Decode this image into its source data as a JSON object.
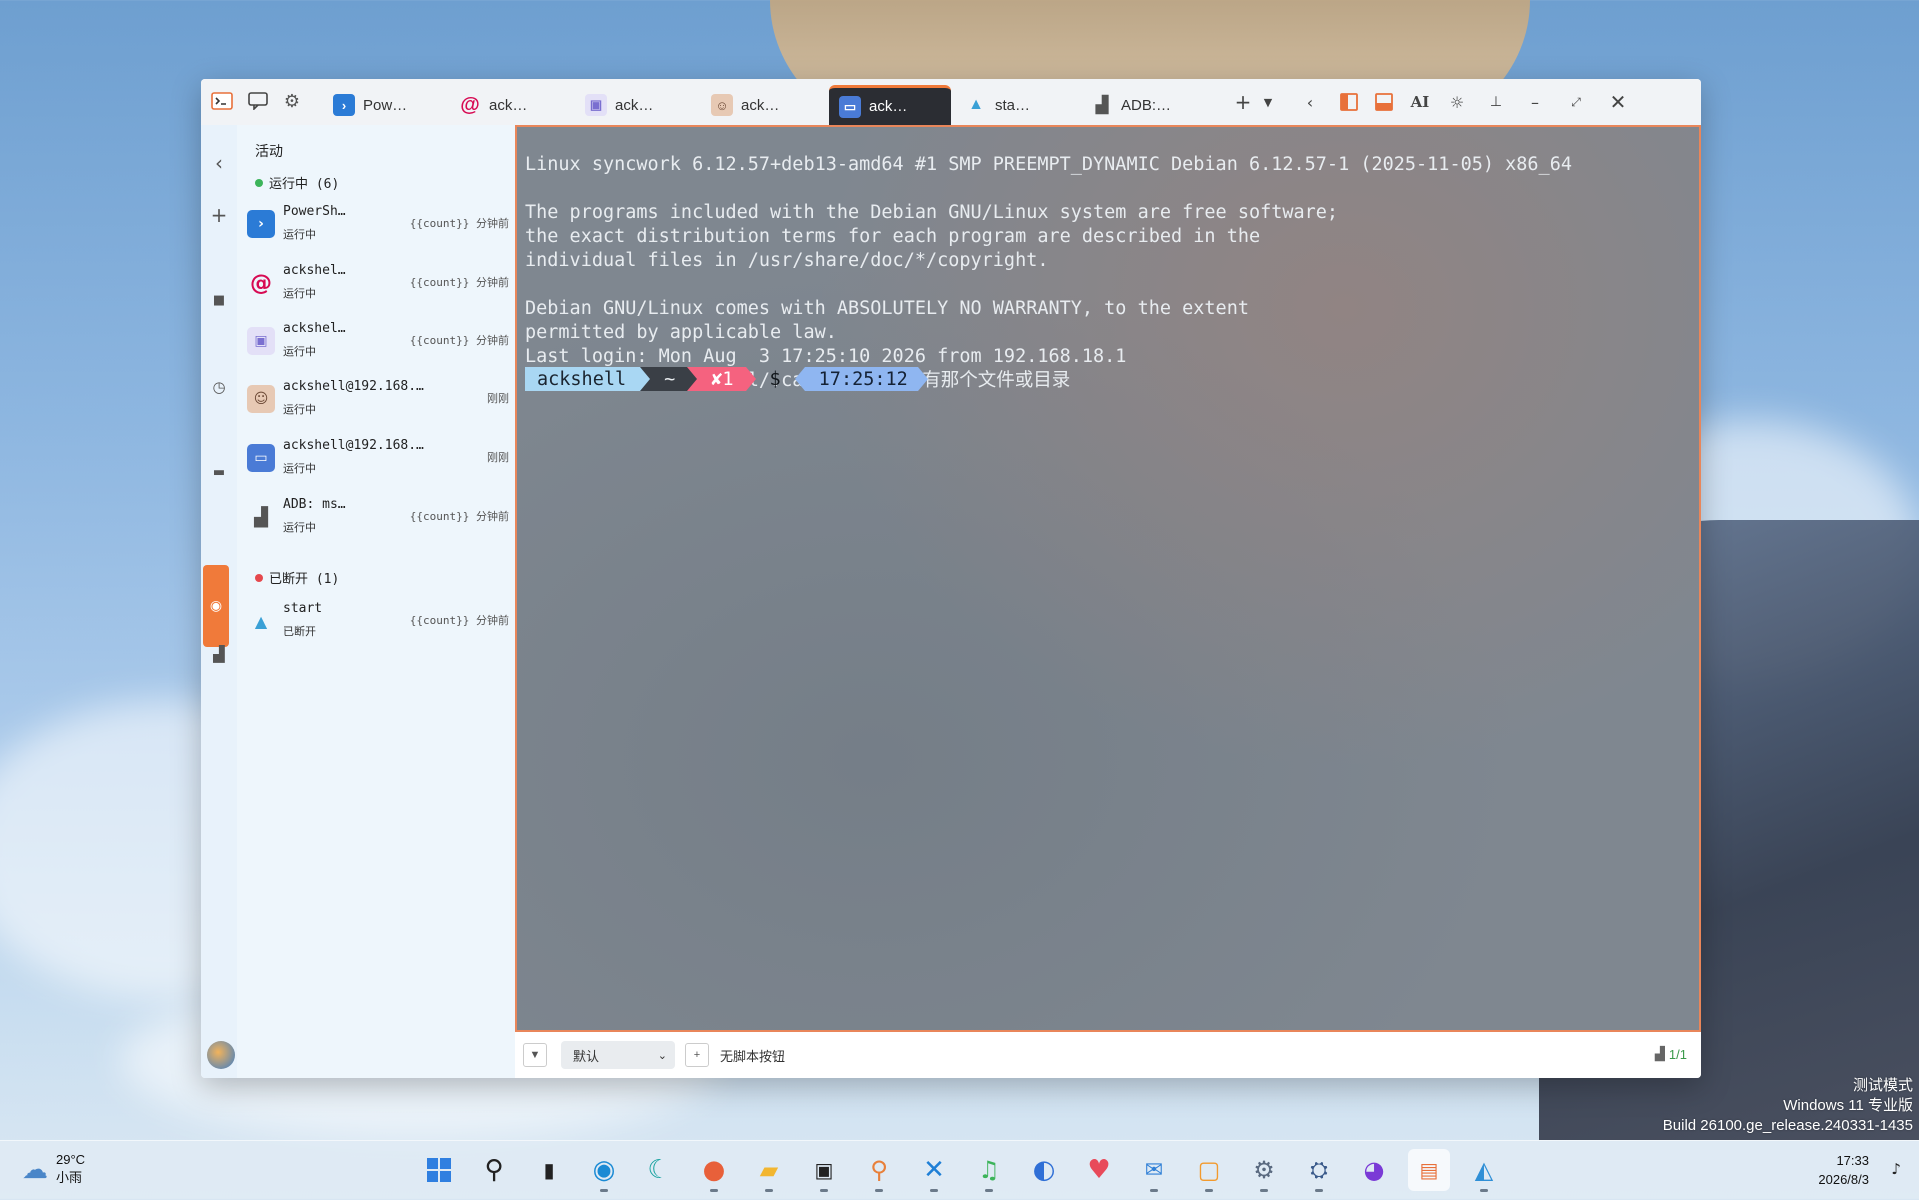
{
  "titlebar": {
    "tabs": [
      {
        "label": "Pow…",
        "icon": "powershell-icon",
        "color": "#2b7bd6"
      },
      {
        "label": "ack…",
        "icon": "debian-icon",
        "color": "#d70a53"
      },
      {
        "label": "ack…",
        "icon": "server-icon",
        "color": "#7a6fd0"
      },
      {
        "label": "ack…",
        "icon": "avatar-icon",
        "color": "#c89a7a"
      },
      {
        "label": "ack…",
        "icon": "remote-desktop-icon",
        "color": "#4a7bd6",
        "active": true
      },
      {
        "label": "sta…",
        "icon": "rocket-icon",
        "color": "#3aa0d6"
      },
      {
        "label": "ADB:…",
        "icon": "android-icon",
        "color": "#555555"
      }
    ],
    "ai_label": "AI"
  },
  "sidebar": {
    "header": "活动",
    "running_group": "运行中 (6)",
    "disconnected_group": "已断开 (1)",
    "running_sessions": [
      {
        "name": "PowerSh…",
        "status": "运行中",
        "time": "{{count}} 分钟前",
        "icon": "powershell-icon"
      },
      {
        "name": "ackshel…",
        "status": "运行中",
        "time": "{{count}} 分钟前",
        "icon": "debian-icon"
      },
      {
        "name": "ackshel…",
        "status": "运行中",
        "time": "{{count}} 分钟前",
        "icon": "server-icon"
      },
      {
        "name": "ackshell@192.168.…",
        "status": "运行中",
        "time": "刚刚",
        "icon": "avatar-icon"
      },
      {
        "name": "ackshell@192.168.…",
        "status": "运行中",
        "time": "刚刚",
        "icon": "remote-desktop-icon"
      },
      {
        "name": "ADB: ms…",
        "status": "运行中",
        "time": "{{count}} 分钟前",
        "icon": "android-icon"
      }
    ],
    "disconnected_sessions": [
      {
        "name": "start",
        "status": "已断开",
        "time": "{{count}} 分钟前",
        "icon": "rocket-icon"
      }
    ]
  },
  "terminal": {
    "lines": [
      "Linux syncwork 6.12.57+deb13-amd64 #1 SMP PREEMPT_DYNAMIC Debian 6.12.57-1 (2025-11-05) x86_64",
      "",
      "The programs included with the Debian GNU/Linux system are free software;",
      "the exact distribution terms for each program are described in the",
      "individual files in /usr/share/doc/*/copyright.",
      "",
      "Debian GNU/Linux comes with ABSOLUTELY NO WARRANTY, to the extent",
      "permitted by applicable law.",
      "Last login: Mon Aug  3 17:25:10 2026 from 192.168.18.1",
      "-bash: /home/ackshell/.cargo/env: 没有那个文件或目录"
    ],
    "prompt": {
      "user": "ackshell",
      "dir": "~",
      "error": "✘1",
      "symbol": "$",
      "time": "17:25:12"
    }
  },
  "bottombar": {
    "profile": "默认",
    "no_script": "无脚本按钮",
    "counter": "1/1"
  },
  "watermark": {
    "line1": "测试模式",
    "line2": "Windows 11 专业版",
    "line3": "Build 26100.ge_release.240331-1435"
  },
  "taskbar": {
    "weather_temp": "29°C",
    "weather_desc": "小雨",
    "time": "17:33",
    "date": "2026/8/3",
    "apps": [
      "windows-start-icon",
      "search-icon",
      "task-view-icon",
      "edge-icon",
      "browser-icon",
      "firefox-icon",
      "file-explorer-icon",
      "terminal-icon",
      "search-tool-icon",
      "vscode-icon",
      "music-icon",
      "thunderbird-icon",
      "heart-app-icon",
      "mail-app-icon",
      "remote-icon",
      "settings-icon",
      "network-app-icon",
      "cat-app-icon",
      "ackshell-icon",
      "image-app-icon"
    ]
  }
}
